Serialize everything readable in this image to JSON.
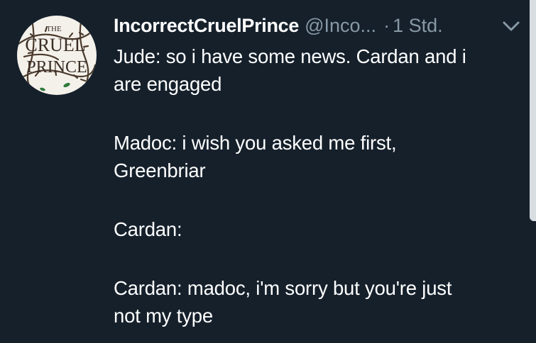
{
  "tweet": {
    "avatar": {
      "line1": "THE",
      "line2": "CRUEL",
      "line3": "PRINCE"
    },
    "display_name": "IncorrectCruelPrince",
    "handle": "@Inco...",
    "separator": "·",
    "timestamp": "1 Std.",
    "menu_icon": "chevron-down-icon",
    "paragraphs": [
      [
        "Jude: so i have some news. Cardan and i",
        "are engaged"
      ],
      [
        "Madoc: i wish you asked me first,",
        "Greenbriar"
      ],
      [
        "Cardan:"
      ],
      [
        "Cardan: madoc, i'm sorry but you're just",
        "not my type"
      ]
    ]
  },
  "colors": {
    "background": "#15202b",
    "text": "#ffffff",
    "muted": "#8899a6"
  }
}
